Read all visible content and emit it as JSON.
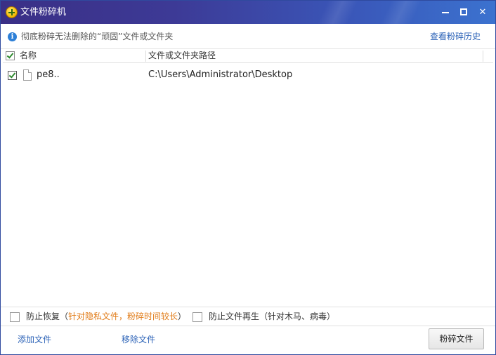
{
  "window": {
    "title": "文件粉碎机",
    "minimize_icon": "minimize-icon",
    "maximize_icon": "maximize-icon",
    "close_symbol": "✕"
  },
  "info": {
    "icon": "info-icon",
    "icon_glyph": "i",
    "text": "彻底粉碎无法删除的“顽固”文件或文件夹",
    "history_link": "查看粉碎历史"
  },
  "table": {
    "columns": {
      "name": "名称",
      "path": "文件或文件夹路径"
    },
    "select_all_checked": true,
    "rows": [
      {
        "checked": true,
        "icon": "file-icon",
        "name": "pe8..",
        "path": "C:\\Users\\Administrator\\Desktop"
      }
    ]
  },
  "options": {
    "prevent_recovery": {
      "checked": false,
      "label": "防止恢复",
      "open_paren": "（",
      "note": "针对隐私文件，粉碎时间较长",
      "close_paren": "）"
    },
    "prevent_regen": {
      "checked": false,
      "label": "防止文件再生",
      "note": "（针对木马、病毒）"
    }
  },
  "footer": {
    "add_file": "添加文件",
    "remove_file": "移除文件",
    "shred_button": "粉碎文件"
  },
  "colors": {
    "title_gradient_start": "#3a2f86",
    "title_gradient_end": "#3b72cf",
    "link": "#2b62b7",
    "note_orange": "#e17b17",
    "check_green": "#2f8a2f"
  }
}
